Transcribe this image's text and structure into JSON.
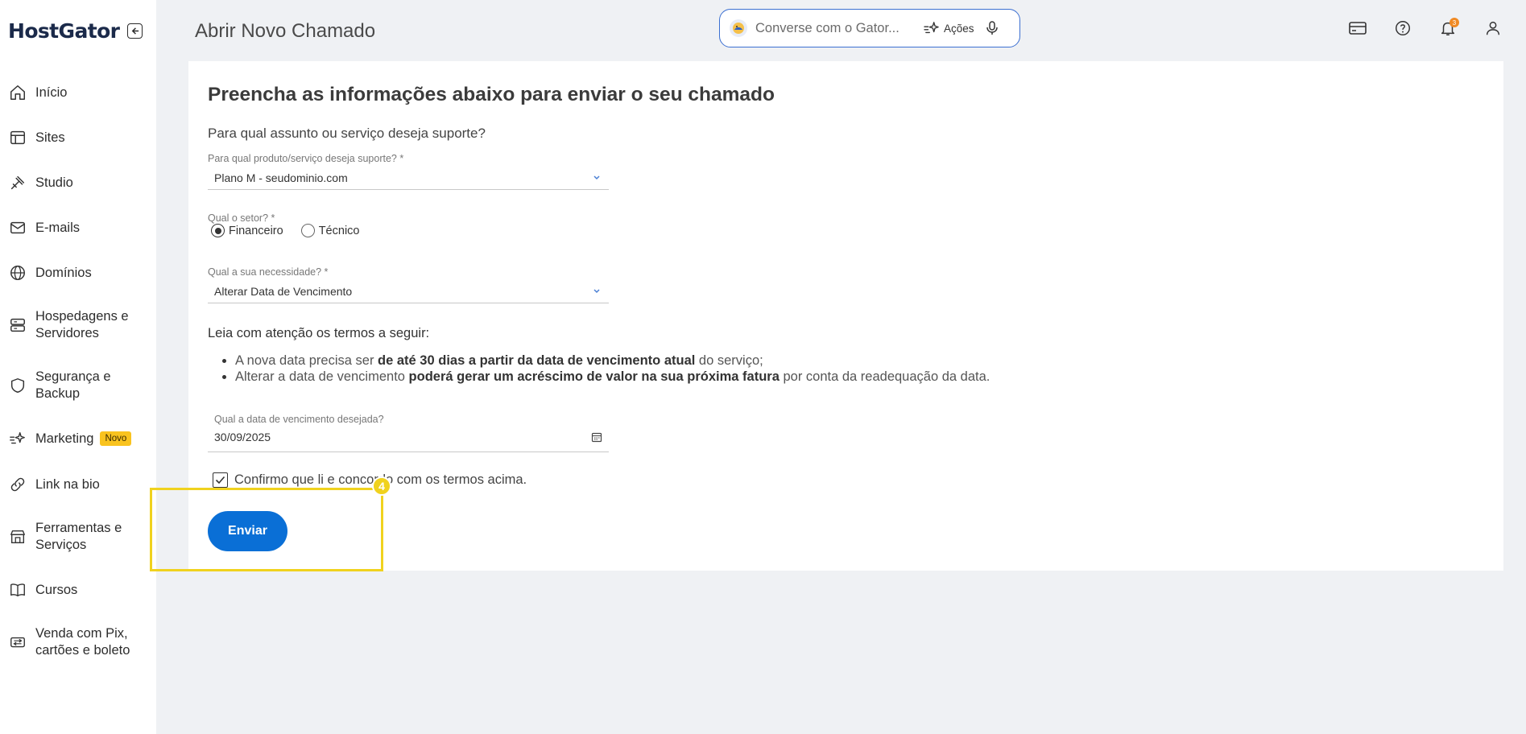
{
  "sidebar": {
    "brand": "HostGator",
    "items": [
      {
        "label": "Início",
        "icon": "home-icon"
      },
      {
        "label": "Sites",
        "icon": "layout-icon"
      },
      {
        "label": "Studio",
        "icon": "studio-icon"
      },
      {
        "label": "E-mails",
        "icon": "mail-icon"
      },
      {
        "label": "Domínios",
        "icon": "globe-icon"
      },
      {
        "label": "Hospedagens e Servidores",
        "icon": "server-icon"
      },
      {
        "label": "Segurança e Backup",
        "icon": "shield-icon"
      },
      {
        "label": "Marketing",
        "icon": "sparkle-icon",
        "badge": "Novo"
      },
      {
        "label": "Link na bio",
        "icon": "link-icon"
      },
      {
        "label": "Ferramentas e Serviços",
        "icon": "tools-icon"
      },
      {
        "label": "Cursos",
        "icon": "book-icon"
      },
      {
        "label": "Venda com Pix, cartões e boleto",
        "icon": "payment-icon"
      }
    ]
  },
  "header": {
    "title": "Abrir Novo Chamado",
    "assistant": {
      "placeholder": "Converse com o Gator...",
      "actions_label": "Ações"
    },
    "notifications_count": "3"
  },
  "form": {
    "heading": "Preencha as informações abaixo para enviar o seu chamado",
    "subject_question": "Para qual assunto ou serviço deseja suporte?",
    "product_label": "Para qual produto/serviço deseja suporte? *",
    "product_value": "Plano M - seudominio.com",
    "sector_label": "Qual o setor? *",
    "sector_options": [
      "Financeiro",
      "Técnico"
    ],
    "sector_selected": "Financeiro",
    "need_label": "Qual a sua necessidade? *",
    "need_value": "Alterar Data de Vencimento",
    "terms_title": "Leia com atenção os termos a seguir:",
    "terms": [
      {
        "pre": "A nova data precisa ser ",
        "bold": "de até 30 dias a partir da data de vencimento atual",
        "post": " do serviço;"
      },
      {
        "pre": "Alterar a data de vencimento ",
        "bold": "poderá gerar um acréscimo de valor na sua próxima fatura",
        "post": " por conta da readequação da data."
      }
    ],
    "date_label": "Qual a data de vencimento desejada?",
    "date_value": "30/09/2025",
    "confirm_label": "Confirmo que li e concordo com os termos acima.",
    "confirm_checked": true,
    "submit_label": "Enviar"
  },
  "overlay": {
    "step": "4",
    "color": "#f0d21e"
  },
  "colors": {
    "primary": "#0a6fd6",
    "badge": "#f9c31f",
    "notification": "#f08a24"
  }
}
